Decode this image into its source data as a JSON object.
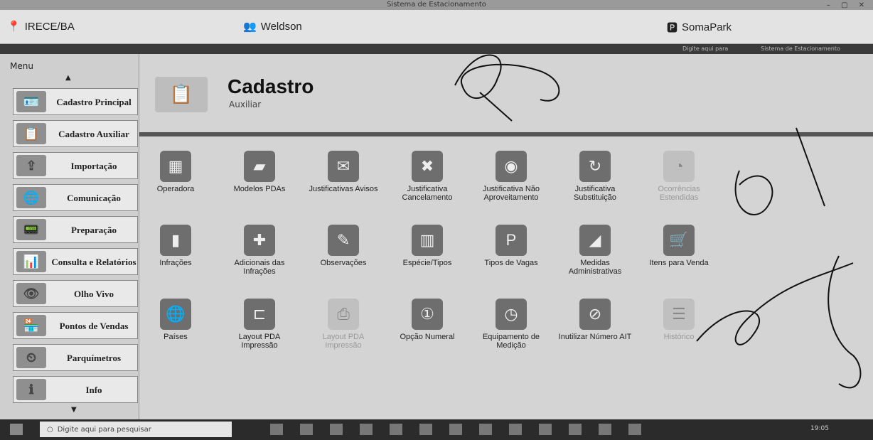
{
  "window": {
    "title": "Sistema de Estacionamento",
    "controls": "– ▢ ✕"
  },
  "infobar": {
    "city": "IRECE/BA",
    "user": "Weldson",
    "brand": "SomaPark",
    "strip_right_1": "Digite aqui para",
    "strip_right_2": "Sistema de Estacionamento"
  },
  "sidebar": {
    "title": "Menu",
    "items": [
      {
        "label": "Cadastro Principal",
        "icon": "id-card-icon"
      },
      {
        "label": "Cadastro Auxiliar",
        "icon": "clipboard-icon"
      },
      {
        "label": "Importação",
        "icon": "import-icon"
      },
      {
        "label": "Comunicação",
        "icon": "globe-icon"
      },
      {
        "label": "Preparação",
        "icon": "device-icon"
      },
      {
        "label": "Consulta e Relatórios",
        "icon": "report-icon"
      },
      {
        "label": "Olho Vivo",
        "icon": "eye-icon"
      },
      {
        "label": "Pontos de Vendas",
        "icon": "store-icon"
      },
      {
        "label": "Parquímetros",
        "icon": "meter-icon"
      },
      {
        "label": "Info",
        "icon": "info-icon"
      }
    ]
  },
  "header": {
    "title": "Cadastro",
    "subtitle": "Auxiliar"
  },
  "tiles": [
    {
      "label": "Operadora",
      "icon": "operator-icon"
    },
    {
      "label": "Modelos PDAs",
      "icon": "pda-icon"
    },
    {
      "label": "Justificativas Avisos",
      "icon": "warning-card-icon"
    },
    {
      "label": "Justificativa Cancelamento",
      "icon": "cancel-icon"
    },
    {
      "label": "Justificativa Não Aproveitamento",
      "icon": "bin-icon"
    },
    {
      "label": "Justificativa Substituição",
      "icon": "swap-icon"
    },
    {
      "label": "Ocorrências Estendidas",
      "icon": "occurrence-icon",
      "faded": true
    },
    {
      "label": "Infrações",
      "icon": "infraction-icon"
    },
    {
      "label": "Adicionais das Infrações",
      "icon": "plus-icon"
    },
    {
      "label": "Observações",
      "icon": "note-icon"
    },
    {
      "label": "Espécie/Tipos",
      "icon": "books-icon"
    },
    {
      "label": "Tipos de Vagas",
      "icon": "parking-icon"
    },
    {
      "label": "Medidas Administrativas",
      "icon": "measure-icon"
    },
    {
      "label": "Itens para Venda",
      "icon": "cart-icon"
    },
    {
      "label": "Países",
      "icon": "globe-icon"
    },
    {
      "label": "Layout PDA Impressão",
      "icon": "layout-icon"
    },
    {
      "label": "Layout PDA Impressão",
      "icon": "printer-icon",
      "faded": true
    },
    {
      "label": "Opção Numeral",
      "icon": "number-icon"
    },
    {
      "label": "Equipamento de Medição",
      "icon": "gauge-icon"
    },
    {
      "label": "Inutilizar Número AIT",
      "icon": "disable-icon"
    },
    {
      "label": "Histórico",
      "icon": "history-icon",
      "faded": true
    }
  ],
  "taskbar": {
    "search_placeholder": "Digite aqui para pesquisar",
    "clock": "19:05"
  }
}
